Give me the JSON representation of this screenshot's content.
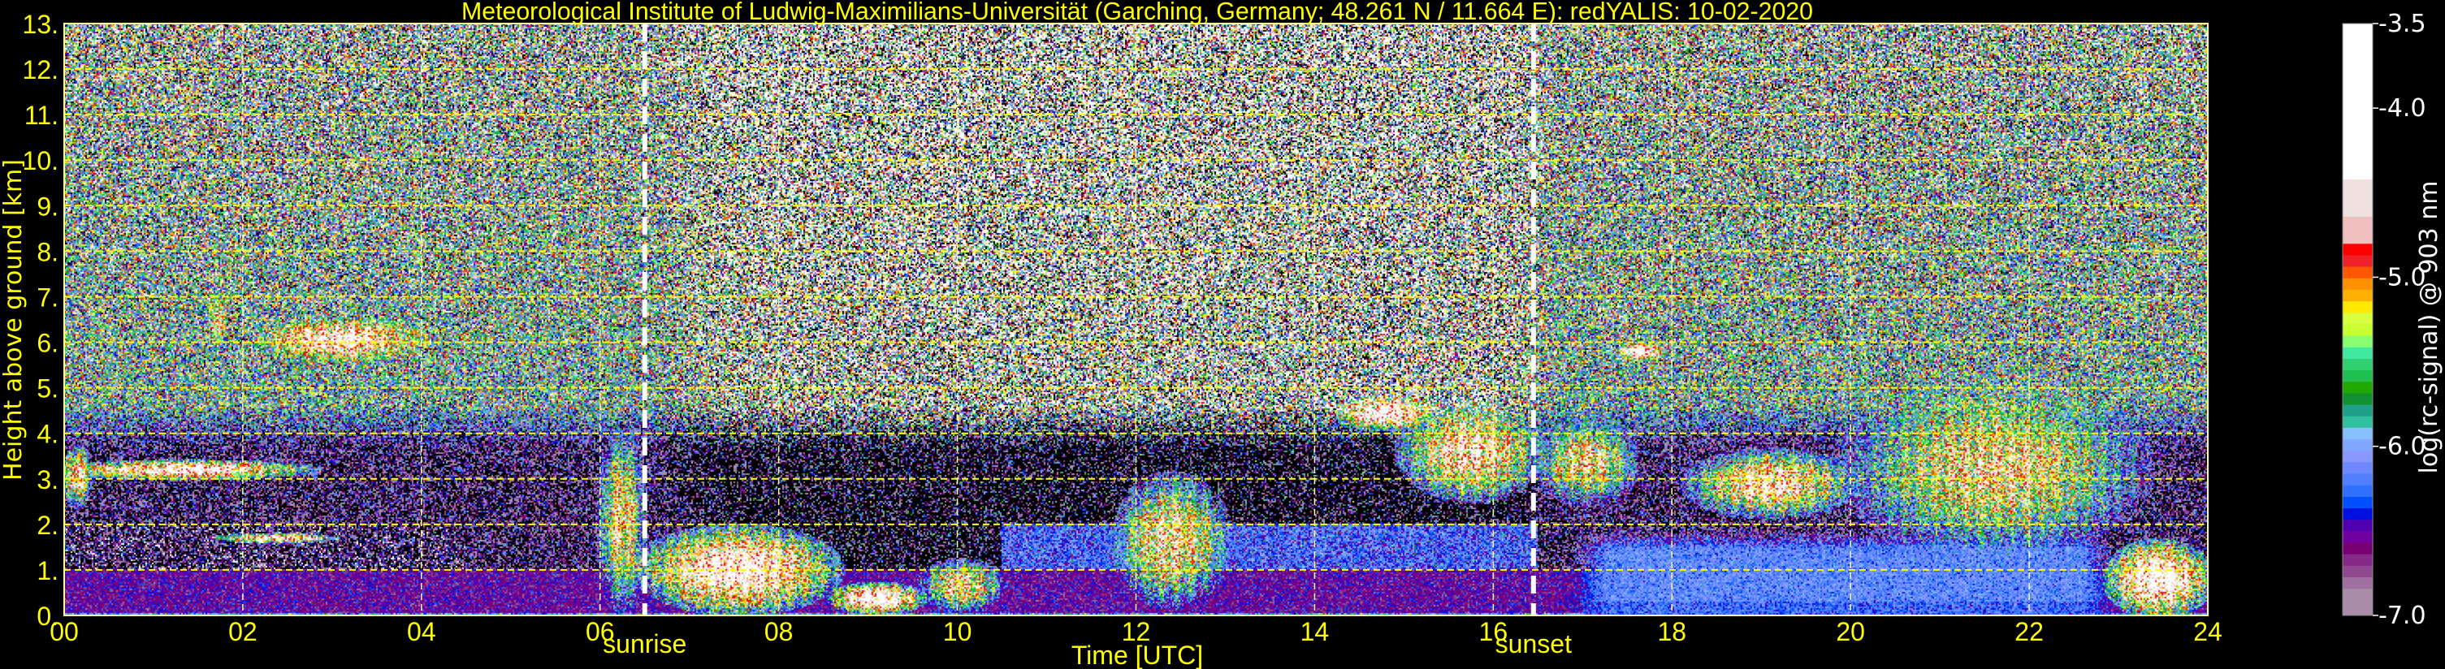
{
  "chart_data": {
    "type": "heatmap",
    "title": "Meteorological Institute of Ludwig-Maximilians-Universität (Garching, Germany; 48.261 N / 11.664 E):    redYALIS: 10-02-2020",
    "xlabel": "Time [UTC]",
    "ylabel": "Height above ground [km]",
    "xlim": [
      0,
      24
    ],
    "ylim": [
      0,
      13
    ],
    "x_ticks": [
      "00",
      "02",
      "04",
      "06",
      "08",
      "10",
      "12",
      "14",
      "16",
      "18",
      "20",
      "22",
      "24"
    ],
    "y_ticks": [
      "0.",
      "1.",
      "2.",
      "3.",
      "4.",
      "5.",
      "6.",
      "7.",
      "8.",
      "9.",
      "10.",
      "11.",
      "12.",
      "13."
    ],
    "grid": true,
    "grid_color": "#ffff00",
    "text_color": "#ffff00",
    "annotations": [
      {
        "label": "sunrise",
        "time": 6.5
      },
      {
        "label": "sunset",
        "time": 16.45
      }
    ],
    "colorbar": {
      "label": "log(rc-signal) @ 903 nm",
      "range": [
        -7.0,
        -3.5
      ],
      "ticks": [
        "-3.5",
        "-4.0",
        "-5.0",
        "-6.0",
        "-7.0"
      ],
      "tick_values": [
        -3.5,
        -4.0,
        -5.0,
        -6.0,
        -7.0
      ],
      "colors_bottom_to_top": [
        "#a88ca8",
        "#a070a0",
        "#904890",
        "#882888",
        "#780070",
        "#7000a0",
        "#5000b0",
        "#0010e0",
        "#0050ff",
        "#3070ff",
        "#5080ff",
        "#7088ff",
        "#8898ff",
        "#80a8ff",
        "#88c0ff",
        "#30c0a0",
        "#20a088",
        "#109030",
        "#20a800",
        "#20c050",
        "#30d070",
        "#40e8a0",
        "#88ff70",
        "#c8ff30",
        "#d8ff40",
        "#ffe800",
        "#ffb000",
        "#ff9000",
        "#ff5800",
        "#f02028",
        "#ff0000",
        "#f0c0c0",
        "#f0e0e0",
        "#ffffff"
      ]
    },
    "features": [
      {
        "t": [
          0.0,
          2.7
        ],
        "h": [
          3.0,
          3.4
        ],
        "v": -4.0
      },
      {
        "t": [
          0.0,
          0.3
        ],
        "h": [
          2.4,
          3.7
        ],
        "v": -4.4
      },
      {
        "t": [
          1.7,
          3.0
        ],
        "h": [
          1.6,
          1.8
        ],
        "v": -4.2
      },
      {
        "t": [
          1.6,
          1.8
        ],
        "h": [
          5.8,
          7.2
        ],
        "v": -4.6
      },
      {
        "t": [
          2.2,
          4.0
        ],
        "h": [
          5.6,
          6.5
        ],
        "v": -4.1
      },
      {
        "t": [
          0.55,
          0.7
        ],
        "h": [
          11.6,
          12.0
        ],
        "v": -4.5
      },
      {
        "t": [
          6.0,
          6.5
        ],
        "h": [
          0.2,
          4.0
        ],
        "v": -4.6
      },
      {
        "t": [
          6.5,
          8.6
        ],
        "h": [
          0.1,
          1.9
        ],
        "v": -4.0
      },
      {
        "t": [
          8.6,
          9.6
        ],
        "h": [
          0.05,
          0.7
        ],
        "v": -3.9
      },
      {
        "t": [
          9.6,
          10.5
        ],
        "h": [
          0.1,
          1.2
        ],
        "v": -4.6
      },
      {
        "t": [
          11.8,
          13.0
        ],
        "h": [
          0.3,
          3.0
        ],
        "v": -4.5
      },
      {
        "t": [
          14.3,
          15.3
        ],
        "h": [
          4.1,
          4.8
        ],
        "v": -4.0
      },
      {
        "t": [
          15.0,
          16.5
        ],
        "h": [
          2.6,
          4.6
        ],
        "v": -4.3
      },
      {
        "t": [
          16.5,
          17.6
        ],
        "h": [
          2.5,
          4.3
        ],
        "v": -4.6
      },
      {
        "t": [
          16.5,
          16.6
        ],
        "h": [
          6.2,
          6.6
        ],
        "v": -4.4
      },
      {
        "t": [
          17.4,
          17.9
        ],
        "h": [
          5.6,
          6.0
        ],
        "v": -3.9
      },
      {
        "t": [
          18.2,
          20.0
        ],
        "h": [
          2.2,
          3.6
        ],
        "v": -4.3
      },
      {
        "t": [
          20.0,
          23.2
        ],
        "h": [
          1.5,
          5.0
        ],
        "v": -4.6
      },
      {
        "t": [
          22.9,
          24.0
        ],
        "h": [
          0.0,
          1.6
        ],
        "v": -3.9
      }
    ]
  }
}
